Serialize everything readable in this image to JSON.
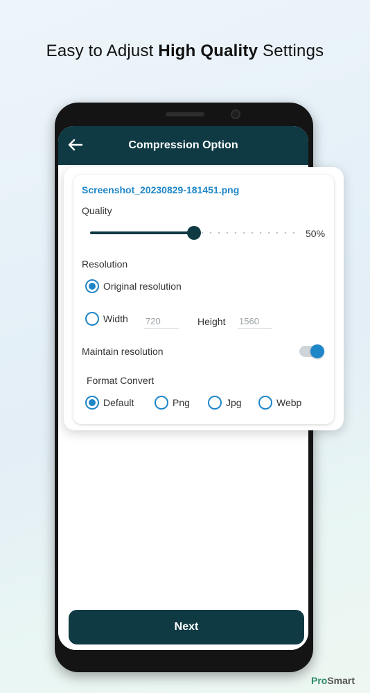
{
  "headline": {
    "pre": "Easy to Adjust ",
    "bold": "High Quality",
    "post": " Settings"
  },
  "appbar": {
    "title": "Compression Option"
  },
  "card": {
    "filename": "Screenshot_20230829-181451.png",
    "quality_label": "Quality",
    "quality_value": "50%",
    "quality_fraction": 0.5,
    "resolution_label": "Resolution",
    "original_label": "Original resolution",
    "width_label": "Width",
    "width_placeholder": "720",
    "height_label": "Height",
    "height_placeholder": "1560",
    "maintain_label": "Maintain resolution",
    "maintain_on": true,
    "format_label": "Format Convert",
    "formats": [
      "Default",
      "Png",
      "Jpg",
      "Webp"
    ],
    "selected_format": "Default"
  },
  "next_label": "Next",
  "brand": {
    "a": "Pro",
    "b": "Smart"
  },
  "colors": {
    "primary": "#0f3a44",
    "accent": "#1f86c8"
  }
}
